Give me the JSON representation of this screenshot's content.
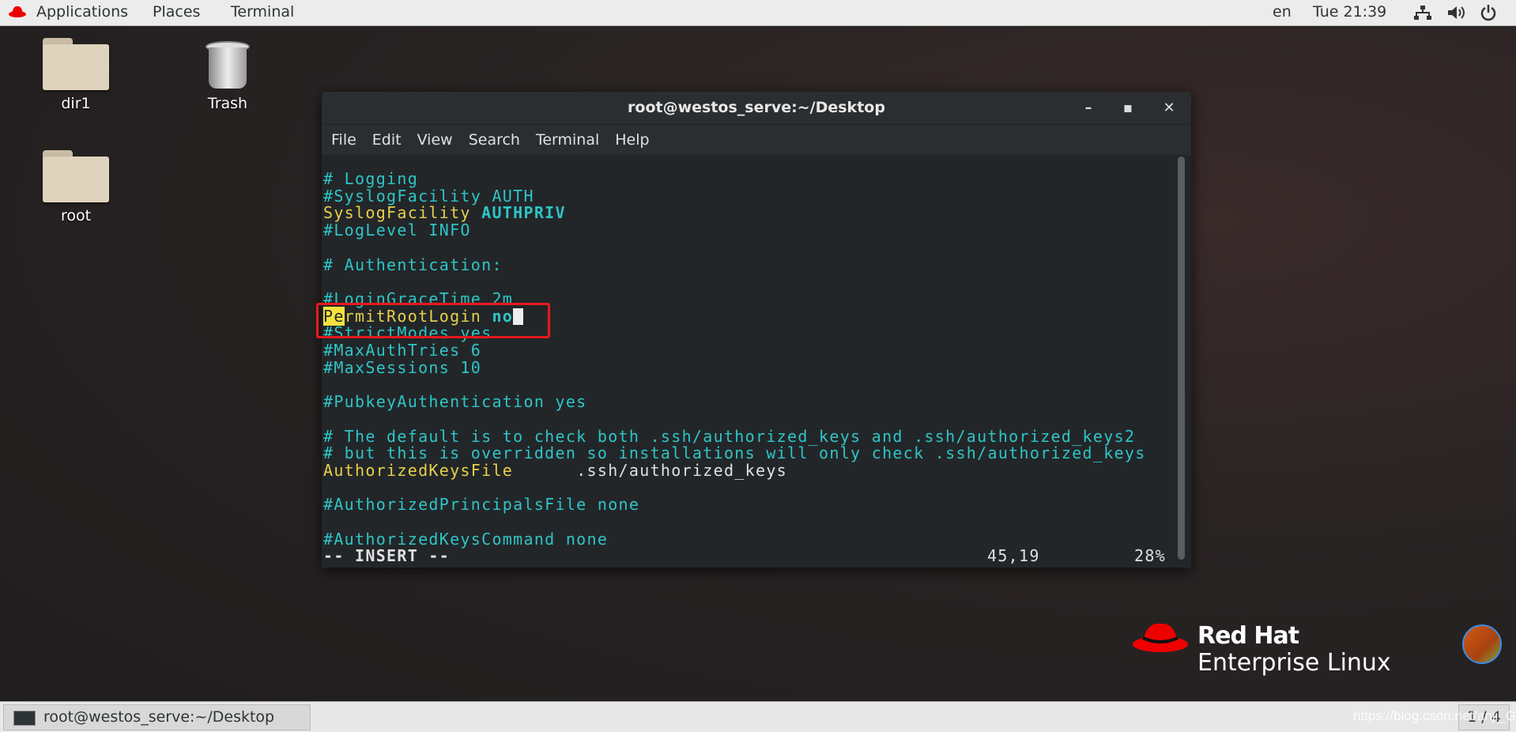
{
  "topbar": {
    "applications": "Applications",
    "places": "Places",
    "terminal": "Terminal",
    "lang": "en",
    "clock": "Tue 21:39"
  },
  "desktop": {
    "icons": [
      {
        "label": "dir1"
      },
      {
        "label": "Trash"
      },
      {
        "label": "root"
      }
    ]
  },
  "window": {
    "title": "root@westos_serve:~/Desktop",
    "menu": [
      "File",
      "Edit",
      "View",
      "Search",
      "Terminal",
      "Help"
    ]
  },
  "editor": {
    "lines": [
      "# Logging",
      "#SyslogFacility AUTH",
      "SyslogFacility",
      "AUTHPRIV",
      "#LogLevel INFO",
      "",
      "# Authentication:",
      "",
      "#LoginGraceTime 2m",
      "Pe",
      "rmitRootLogin",
      "no",
      "#StrictModes yes",
      "#MaxAuthTries 6",
      "#MaxSessions 10",
      "",
      "#PubkeyAuthentication yes",
      "",
      "# The default is to check both .ssh/authorized_keys and .ssh/authorized_keys2",
      "# but this is overridden so installations will only check .ssh/authorized_keys",
      "AuthorizedKeysFile",
      ".ssh/authorized_keys",
      "",
      "#AuthorizedPrincipalsFile none",
      "",
      "#AuthorizedKeysCommand none"
    ],
    "mode": "-- INSERT --",
    "position": "45,19",
    "percent": "28%"
  },
  "branding": {
    "line1": "Red Hat",
    "line2": "Enterprise Linux"
  },
  "taskbar": {
    "task": "root@westos_serve:~/Desktop",
    "workspace": "1 / 4",
    "watermark": "https://blog.csdn.net/anji_G"
  },
  "colors": {
    "accent_red": "#ee0000",
    "highlight_box": "#e8191d",
    "terminal_bg": "#232629",
    "comment": "#2ec5c6",
    "keyword": "#e6d04a"
  }
}
